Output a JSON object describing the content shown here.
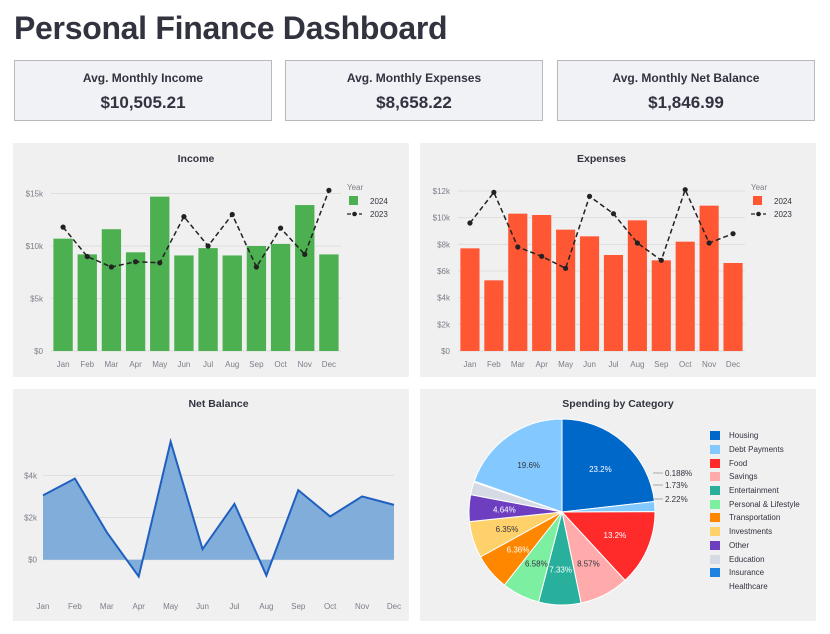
{
  "page": {
    "title": "Personal Finance Dashboard"
  },
  "metrics": [
    {
      "label": "Avg. Monthly Income",
      "value": "$10,505.21"
    },
    {
      "label": "Avg. Monthly Expenses",
      "value": "$8,658.22"
    },
    {
      "label": "Avg. Monthly Net Balance",
      "value": "$1,846.99"
    }
  ],
  "chart_data": [
    {
      "type": "bar",
      "title": "Income",
      "categories": [
        "Jan",
        "Feb",
        "Mar",
        "Apr",
        "May",
        "Jun",
        "Jul",
        "Aug",
        "Sep",
        "Oct",
        "Nov",
        "Dec"
      ],
      "legend_title": "Year",
      "legend_position": "top-right",
      "series": [
        {
          "name": "2024",
          "kind": "bar",
          "color": "#4caf50",
          "values": [
            10700,
            9200,
            11600,
            9400,
            14700,
            9100,
            9800,
            9100,
            10000,
            10200,
            13900,
            9200
          ]
        },
        {
          "name": "2023",
          "kind": "line",
          "color": "#222222",
          "values": [
            11800,
            9000,
            8000,
            8500,
            8400,
            12800,
            10000,
            13000,
            8000,
            11700,
            9200,
            15300
          ]
        }
      ],
      "y_ticks": [
        "$0",
        "$5k",
        "$10k",
        "$15k"
      ],
      "ylim": [
        0,
        16000
      ],
      "grid": true
    },
    {
      "type": "bar",
      "title": "Expenses",
      "categories": [
        "Jan",
        "Feb",
        "Mar",
        "Apr",
        "May",
        "Jun",
        "Jul",
        "Aug",
        "Sep",
        "Oct",
        "Nov",
        "Dec"
      ],
      "legend_title": "Year",
      "legend_position": "top-right",
      "series": [
        {
          "name": "2024",
          "kind": "bar",
          "color": "#ff5733",
          "values": [
            7700,
            5300,
            10300,
            10200,
            9100,
            8600,
            7200,
            9800,
            6800,
            8200,
            10900,
            6600
          ]
        },
        {
          "name": "2023",
          "kind": "line",
          "color": "#222222",
          "values": [
            9600,
            11900,
            7800,
            7100,
            6200,
            11600,
            10300,
            8100,
            6800,
            12100,
            8100,
            8800
          ]
        }
      ],
      "y_ticks": [
        "$0",
        "$2k",
        "$4k",
        "$6k",
        "$8k",
        "$10k",
        "$12k"
      ],
      "ylim": [
        0,
        12600
      ],
      "grid": true
    },
    {
      "type": "area",
      "title": "Net Balance",
      "categories": [
        "Jan",
        "Feb",
        "Mar",
        "Apr",
        "May",
        "Jun",
        "Jul",
        "Aug",
        "Sep",
        "Oct",
        "Nov",
        "Dec"
      ],
      "series": [
        {
          "color": "#1f5fbf",
          "fill": "#7aa9d9",
          "values": [
            3050,
            3850,
            1300,
            -800,
            5600,
            500,
            2650,
            -750,
            3300,
            2050,
            3000,
            2600
          ]
        }
      ],
      "y_ticks": [
        "$0",
        "$2k",
        "$4k"
      ],
      "ylim": [
        -1200,
        6200
      ],
      "grid": true
    },
    {
      "type": "pie",
      "title": "Spending by Category",
      "legend_position": "right",
      "slices": [
        {
          "label": "Housing",
          "value": 23.2,
          "text": "23.2%",
          "color": "#0068c9"
        },
        {
          "label": "Debt Payments",
          "value": 1.73,
          "text": "1.73%",
          "color": "#83c9ff"
        },
        {
          "label": "Food",
          "value": 13.2,
          "text": "13.2%",
          "color": "#ff2b2b"
        },
        {
          "label": "Savings",
          "value": 8.57,
          "text": "8.57%",
          "color": "#ffabab"
        },
        {
          "label": "Entertainment",
          "value": 7.33,
          "text": "7.33%",
          "color": "#29b09d"
        },
        {
          "label": "Personal & Lifestyle",
          "value": 6.58,
          "text": "6.58%",
          "color": "#7defa1"
        },
        {
          "label": "Transportation",
          "value": 6.36,
          "text": "6.36%",
          "color": "#ff8700"
        },
        {
          "label": "Investments",
          "value": 6.35,
          "text": "6.35%",
          "color": "#ffd16a"
        },
        {
          "label": "Other",
          "value": 4.64,
          "text": "4.64%",
          "color": "#6d3fc0"
        },
        {
          "label": "Education",
          "value": 2.22,
          "text": "2.22%",
          "color": "#d5dae5"
        },
        {
          "label": "Insurance",
          "value": 0.188,
          "text": "0.188%",
          "color": "#1c83e1"
        },
        {
          "label": "Healthcare",
          "value": 19.6,
          "text": "19.6%",
          "color": "#83c9ff"
        }
      ]
    }
  ]
}
